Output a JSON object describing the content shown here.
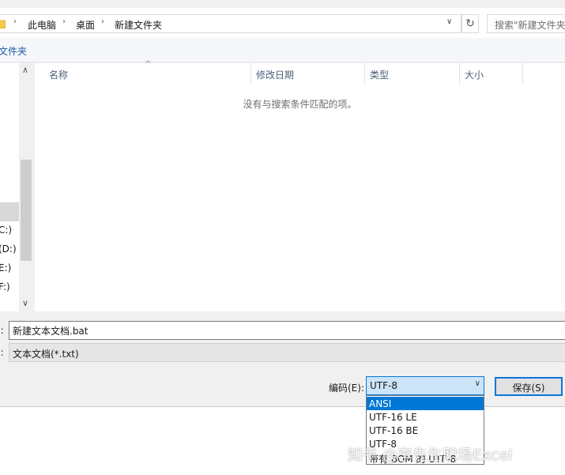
{
  "address_bar": {
    "breadcrumbs": [
      "此电脑",
      "桌面",
      "新建文件夹"
    ],
    "search_placeholder": "搜索\"新建文件夹\""
  },
  "toolbar": {
    "new_folder_label": "文件夹"
  },
  "nav": {
    "drives": [
      "C:)",
      "(D:)",
      "E:)",
      "F:)"
    ]
  },
  "file_list": {
    "columns": [
      "名称",
      "修改日期",
      "类型",
      "大小"
    ],
    "empty_message": "没有与搜索条件匹配的项。"
  },
  "form": {
    "filename_label": "):",
    "filename_value": "新建文本文档.bat",
    "filetype_label": "):",
    "filetype_value": "文本文档(*.txt)",
    "encoding_label": "编码(E):",
    "encoding_value": "UTF-8",
    "save_label": "保存(S)"
  },
  "encoding_options": [
    {
      "label": "ANSI",
      "selected": true
    },
    {
      "label": "UTF-16 LE",
      "selected": false
    },
    {
      "label": "UTF-16 BE",
      "selected": false
    },
    {
      "label": "UTF-8",
      "selected": false
    },
    {
      "label": "带有 BOM 的 UTF-8",
      "selected": false
    }
  ],
  "watermark": "知乎 @李先生职场Excel",
  "colors": {
    "accent": "#0078d7",
    "selection": "#cce4f7",
    "link": "#1c5aa6"
  }
}
